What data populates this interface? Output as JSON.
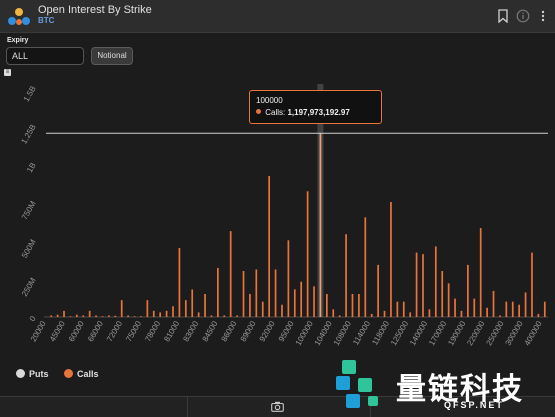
{
  "header": {
    "title": "Open Interest By Strike",
    "subtitle": "BTC",
    "icons": [
      "bookmark-icon",
      "info-icon",
      "more-vertical-icon"
    ]
  },
  "controls": {
    "label": "Expiry",
    "expiry_value": "ALL",
    "notional_label": "Notional"
  },
  "tooltip": {
    "strike": "100000",
    "series": "Calls:",
    "value": "1,197,973,192.97"
  },
  "legend": {
    "puts_label": "Puts",
    "calls_label": "Calls"
  },
  "watermark": {
    "text": "量链科技",
    "sub": "QFSP.NET"
  },
  "colors": {
    "calls": "#e8743b",
    "puts": "#d9d9d9",
    "highlight": "#f0a070",
    "brand": "#2fc49a"
  },
  "chart_data": {
    "type": "bar",
    "title": "Open Interest By Strike",
    "ylim": [
      0,
      1500000000
    ],
    "y_ticks": [
      0,
      250000000,
      500000000,
      750000000,
      1000000000,
      1250000000,
      1500000000
    ],
    "y_tick_labels": [
      "0",
      "250M",
      "500M",
      "750M",
      "1B",
      "1.25B",
      "1.5B"
    ],
    "x_tick_labels": [
      "20000",
      "45000",
      "60000",
      "66000",
      "72000",
      "75000",
      "78000",
      "81000",
      "83000",
      "84500",
      "86000",
      "89000",
      "92000",
      "95000",
      "100000",
      "104000",
      "108000",
      "114000",
      "118000",
      "125000",
      "140000",
      "170000",
      "190000",
      "220000",
      "250000",
      "300000",
      "400000"
    ],
    "crosshair_value": 1197973192.97,
    "highlight_index": 42,
    "series": [
      {
        "name": "Calls",
        "values": [
          10000000,
          15000000,
          40000000,
          5000000,
          15000000,
          10000000,
          40000000,
          10000000,
          5000000,
          10000000,
          8000000,
          110000000,
          10000000,
          5000000,
          5000000,
          110000000,
          40000000,
          30000000,
          40000000,
          70000000,
          450000000,
          110000000,
          180000000,
          30000000,
          150000000,
          10000000,
          320000000,
          10000000,
          560000000,
          10000000,
          300000000,
          150000000,
          310000000,
          100000000,
          920000000,
          310000000,
          80000000,
          500000000,
          180000000,
          230000000,
          820000000,
          200000000,
          1197973192.97,
          150000000,
          50000000,
          10000000,
          540000000,
          150000000,
          150000000,
          650000000,
          20000000,
          340000000,
          40000000,
          750000000,
          100000000,
          100000000,
          30000000,
          420000000,
          410000000,
          50000000,
          460000000,
          300000000,
          220000000,
          120000000,
          40000000,
          340000000,
          120000000,
          580000000,
          60000000,
          170000000,
          10000000,
          100000000,
          100000000,
          80000000,
          160000000,
          420000000,
          20000000,
          100000000
        ]
      }
    ]
  }
}
